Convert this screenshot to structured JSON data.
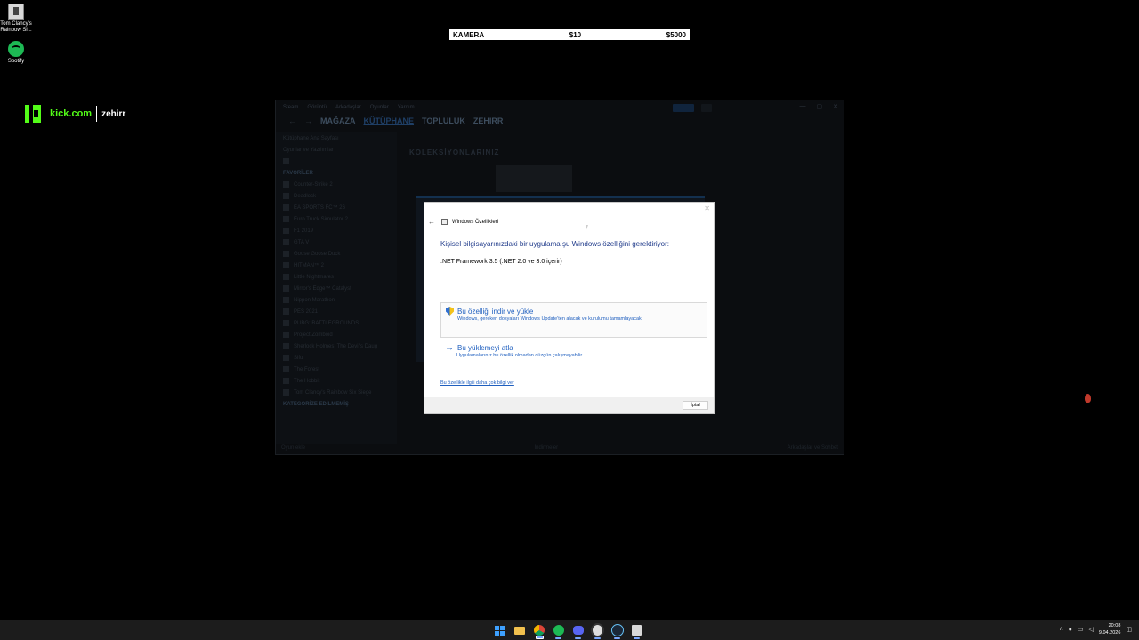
{
  "desktop": {
    "icons": [
      {
        "label": "Tom Clancy's Rainbow Si..."
      },
      {
        "label": "Spotify"
      }
    ]
  },
  "stream_overlay": {
    "brand": "kick.com",
    "username": "zehirr",
    "camera_row": {
      "label": "KAMERA",
      "price1": "$10",
      "price2": "$5000"
    }
  },
  "steam": {
    "menu": [
      "Steam",
      "Görüntü",
      "Arkadaşlar",
      "Oyunlar",
      "Yardım"
    ],
    "nav": [
      "MAĞAZA",
      "KÜTÜPHANE",
      "TOPLULUK",
      "ZEHIRR"
    ],
    "active_nav": "KÜTÜPHANE",
    "sidebar_home": "Kütüphane Ana Sayfası",
    "sidebar_filter": "Oyunlar ve Yazılımlar",
    "favorites_header": "FAVORİLER",
    "games": [
      "Counter-Strike 2",
      "Deadlock",
      "EA SPORTS FC™ 26",
      "Euro Truck Simulator 2",
      "F1 2019",
      "GTA V",
      "Goose Goose Duck",
      "HITMAN™ 2",
      "Little Nightmares",
      "Mirror's Edge™ Catalyst",
      "Nippon Marathon",
      "PES 2021",
      "PUBG: BATTLEGROUNDS",
      "Project Zomboid",
      "Sherlock Holmes: The Devil's Daug",
      "Sifu",
      "The Forest",
      "The Hobbit",
      "Tom Clancy's Rainbow Six Siege"
    ],
    "uncategorized": "KATEGORİZE EDİLMEMİŞ",
    "collections_title": "KOLEKSİYONLARINIZ",
    "bottom_left": "Oyun ekle",
    "bottom_center": "İndirmeler",
    "bottom_right": "Arkadaşlar ve Sohbet"
  },
  "dialog": {
    "title": "Windows Özellikleri",
    "heading": "Kişisel bilgisayarınızdaki bir uygulama şu Windows özelliğini gerektiriyor:",
    "feature": ".NET Framework 3.5 (.NET 2.0 ve 3.0 içerir)",
    "option1_title": "Bu özelliği indir ve yükle",
    "option1_desc": "Windows, gereken dosyaları Windows Update'ten alacak ve kurulumu tamamlayacak.",
    "option2_title": "Bu yüklemeyi atla",
    "option2_desc": "Uygulamalarınız bu özellik olmadan düzgün çalışmayabilir.",
    "more_info_link": "Bu özellikle ilgili daha çok bilgi ver",
    "cancel_label": "İptal"
  },
  "taskbar": {
    "pinned": [
      "start",
      "file-explorer",
      "chrome",
      "spotify",
      "discord",
      "obs",
      "steam",
      "rainbow-six"
    ],
    "time": "20:08",
    "date": "9.04.2026"
  },
  "colors": {
    "kick_green": "#53fc18",
    "dialog_link_blue": "#1f5fbf",
    "dialog_heading_blue": "#1f3a8a",
    "taskbar_bg": "#1c1c1c"
  }
}
